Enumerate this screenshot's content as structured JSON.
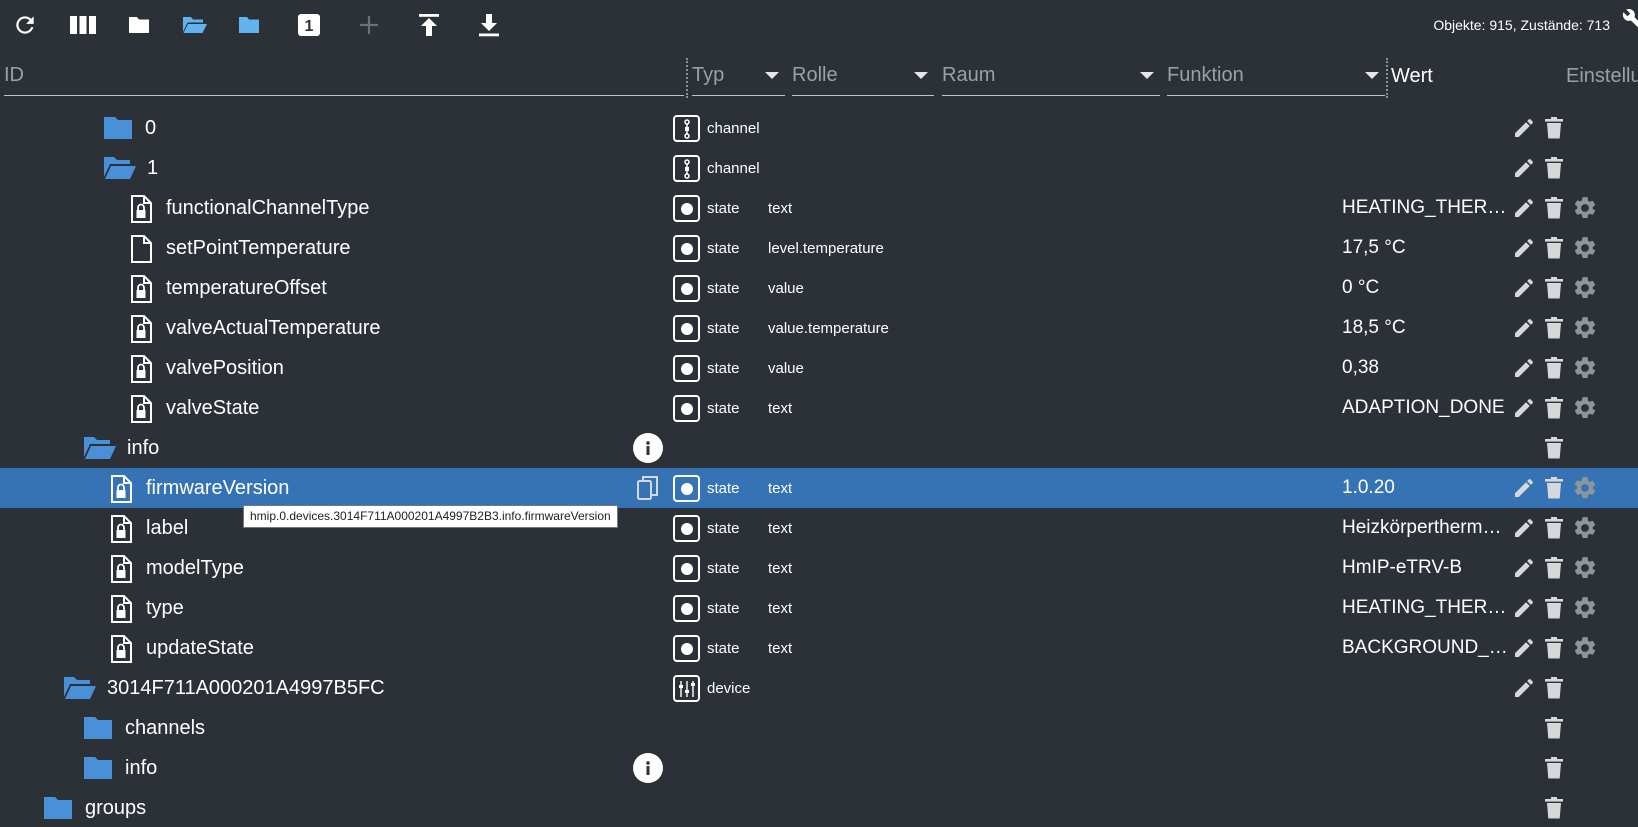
{
  "toolbar": {
    "buttons": [
      {
        "name": "refresh-icon"
      },
      {
        "name": "columns-icon"
      },
      {
        "name": "folder-closed-icon"
      },
      {
        "name": "folder-open-icon"
      },
      {
        "name": "folder-icon"
      },
      {
        "name": "number-one-icon",
        "label": "1"
      },
      {
        "name": "plus-icon"
      },
      {
        "name": "upload-icon"
      },
      {
        "name": "download-icon"
      }
    ],
    "counts": "Objekte: 915, Zustände: 713"
  },
  "filters": {
    "id_placeholder": "ID",
    "typ": "Typ",
    "rolle": "Rolle",
    "raum": "Raum",
    "funktion": "Funktion",
    "wert": "Wert",
    "einstellungen": "Einstellu"
  },
  "rows": [
    {
      "label": "0",
      "icon": "folder-closed",
      "indent": 103,
      "typ": "channel",
      "typIcon": "channel",
      "rolle": "",
      "wert": "",
      "edit": true,
      "del": true,
      "cfg": false,
      "info": false
    },
    {
      "label": "1",
      "icon": "folder-open",
      "indent": 103,
      "typ": "channel",
      "typIcon": "channel",
      "rolle": "",
      "wert": "",
      "edit": true,
      "del": true,
      "cfg": false,
      "info": false
    },
    {
      "label": "functionalChannelType",
      "icon": "file-lock",
      "indent": 130,
      "typ": "state",
      "typIcon": "state",
      "rolle": "text",
      "wert": "HEATING_THERMOSTAT_CHANNEL",
      "edit": true,
      "del": true,
      "cfg": true,
      "info": false
    },
    {
      "label": "setPointTemperature",
      "icon": "file",
      "indent": 130,
      "typ": "state",
      "typIcon": "state",
      "rolle": "level.temperature",
      "wert": "17,5 °C",
      "edit": true,
      "del": true,
      "cfg": true,
      "info": false
    },
    {
      "label": "temperatureOffset",
      "icon": "file-lock",
      "indent": 130,
      "typ": "state",
      "typIcon": "state",
      "rolle": "value",
      "wert": "0 °C",
      "edit": true,
      "del": true,
      "cfg": true,
      "info": false
    },
    {
      "label": "valveActualTemperature",
      "icon": "file-lock",
      "indent": 130,
      "typ": "state",
      "typIcon": "state",
      "rolle": "value.temperature",
      "wert": "18,5 °C",
      "edit": true,
      "del": true,
      "cfg": true,
      "info": false
    },
    {
      "label": "valvePosition",
      "icon": "file-lock",
      "indent": 130,
      "typ": "state",
      "typIcon": "state",
      "rolle": "value",
      "wert": "0,38",
      "edit": true,
      "del": true,
      "cfg": true,
      "info": false
    },
    {
      "label": "valveState",
      "icon": "file-lock",
      "indent": 130,
      "typ": "state",
      "typIcon": "state",
      "rolle": "text",
      "wert": "ADAPTION_DONE",
      "edit": true,
      "del": true,
      "cfg": true,
      "info": false
    },
    {
      "label": "info",
      "icon": "folder-open",
      "indent": 83,
      "typ": "",
      "typIcon": "",
      "rolle": "",
      "wert": "",
      "edit": false,
      "del": true,
      "cfg": false,
      "info": true
    },
    {
      "label": "firmwareVersion",
      "icon": "file-lock",
      "indent": 110,
      "typ": "state",
      "typIcon": "state",
      "rolle": "text",
      "wert": "1.0.20",
      "edit": true,
      "del": true,
      "cfg": true,
      "info": false,
      "selected": true,
      "copy": true
    },
    {
      "label": "label",
      "icon": "file-lock",
      "indent": 110,
      "typ": "state",
      "typIcon": "state",
      "rolle": "text",
      "wert": "Heizkörperthermostat",
      "edit": true,
      "del": true,
      "cfg": true,
      "info": false
    },
    {
      "label": "modelType",
      "icon": "file-lock",
      "indent": 110,
      "typ": "state",
      "typIcon": "state",
      "rolle": "text",
      "wert": "HmIP-eTRV-B",
      "edit": true,
      "del": true,
      "cfg": true,
      "info": false
    },
    {
      "label": "type",
      "icon": "file-lock",
      "indent": 110,
      "typ": "state",
      "typIcon": "state",
      "rolle": "text",
      "wert": "HEATING_THERMOSTAT",
      "edit": true,
      "del": true,
      "cfg": true,
      "info": false
    },
    {
      "label": "updateState",
      "icon": "file-lock",
      "indent": 110,
      "typ": "state",
      "typIcon": "state",
      "rolle": "text",
      "wert": "BACKGROUND_UPDATE_NOT_SUPPORTED",
      "edit": true,
      "del": true,
      "cfg": true,
      "info": false
    },
    {
      "label": "3014F711A000201A4997B5FC",
      "icon": "folder-open",
      "indent": 63,
      "typ": "device",
      "typIcon": "device",
      "rolle": "",
      "wert": "",
      "edit": true,
      "del": true,
      "cfg": false,
      "info": false
    },
    {
      "label": "channels",
      "icon": "folder-closed",
      "indent": 83,
      "typ": "",
      "typIcon": "",
      "rolle": "",
      "wert": "",
      "edit": false,
      "del": true,
      "cfg": false,
      "info": false
    },
    {
      "label": "info",
      "icon": "folder-closed",
      "indent": 83,
      "typ": "",
      "typIcon": "",
      "rolle": "",
      "wert": "",
      "edit": false,
      "del": true,
      "cfg": false,
      "info": true
    },
    {
      "label": "groups",
      "icon": "folder-closed",
      "indent": 43,
      "typ": "",
      "typIcon": "",
      "rolle": "",
      "wert": "",
      "edit": false,
      "del": true,
      "cfg": false,
      "info": false
    }
  ],
  "tooltip": "hmip.0.devices.3014F711A000201A4997B2B3.info.firmwareVersion",
  "colors": {
    "background": "#2b3136",
    "selected": "#3673b4",
    "folder": "#4a90d9",
    "folder_toolbar": "#61b4ef"
  }
}
